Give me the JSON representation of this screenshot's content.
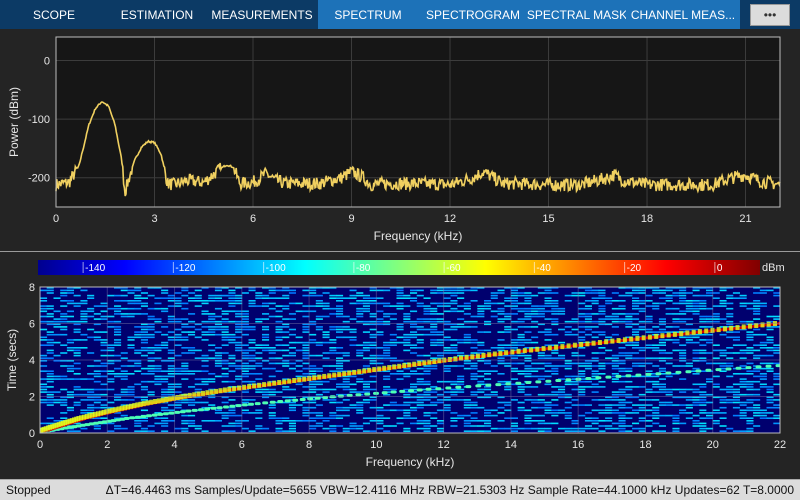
{
  "tabs": [
    {
      "label": "SCOPE",
      "group": 1,
      "w": 108
    },
    {
      "label": "ESTIMATION",
      "group": 1,
      "w": 98
    },
    {
      "label": "MEASUREMENTS",
      "group": 1,
      "w": 112
    },
    {
      "label": "SPECTRUM",
      "group": 2,
      "w": 100
    },
    {
      "label": "SPECTROGRAM",
      "group": 2,
      "w": 110
    },
    {
      "label": "SPECTRAL MASK",
      "group": 2,
      "w": 98
    },
    {
      "label": "CHANNEL MEAS...",
      "group": 2,
      "w": 114
    }
  ],
  "tab_more_icon": "overflow-menu-icon",
  "colors": {
    "spectrum_line": "#f0d060",
    "plot_bg": "#161616",
    "axes_text": "#e6e6e6"
  },
  "status": {
    "state": "Stopped",
    "readout": "ΔT=46.4463 ms  Samples/Update=5655  VBW=12.4116 MHz  RBW=21.5303 Hz  Sample Rate=44.1000 kHz  Updates=62  T=8.0000"
  },
  "chart_data": [
    {
      "type": "line",
      "title": "",
      "xlabel": "Frequency (kHz)",
      "ylabel": "Power (dBm)",
      "xlim": [
        0,
        22.05
      ],
      "ylim": [
        -250,
        40
      ],
      "xticks": [
        0,
        3,
        6,
        9,
        12,
        15,
        18,
        21
      ],
      "yticks": [
        0,
        -100,
        -200
      ],
      "grid": true,
      "series": [
        {
          "x": [
            0.0,
            0.4,
            0.7,
            1.0,
            1.2,
            1.4,
            1.6,
            1.8,
            2.0,
            2.1,
            2.2,
            2.4,
            2.6,
            2.8,
            3.0,
            3.2,
            3.4,
            3.6,
            4.0,
            4.5,
            5.0,
            5.2,
            5.4,
            5.6,
            6.0,
            6.4,
            6.7,
            7.0,
            8.0,
            8.7,
            9.0,
            9.3,
            9.6,
            10.0,
            11.0,
            12.0,
            12.7,
            13.0,
            13.2,
            13.6,
            14.0,
            15.0,
            16.0,
            16.8,
            17.0,
            17.3,
            18.0,
            19.0,
            20.0,
            20.6,
            21.0,
            21.4,
            22.05
          ],
          "y": [
            -212,
            -208,
            -180,
            -110,
            -82,
            -70,
            -78,
            -110,
            -170,
            -225,
            -205,
            -170,
            -148,
            -138,
            -140,
            -160,
            -210,
            -212,
            -205,
            -208,
            -185,
            -178,
            -182,
            -210,
            -208,
            -193,
            -205,
            -210,
            -210,
            -200,
            -190,
            -198,
            -212,
            -210,
            -210,
            -212,
            -200,
            -190,
            -196,
            -210,
            -210,
            -212,
            -212,
            -200,
            -195,
            -205,
            -212,
            -212,
            -212,
            -200,
            -195,
            -205,
            -212
          ]
        }
      ]
    },
    {
      "type": "heatmap",
      "title": "",
      "xlabel": "Frequency (kHz)",
      "ylabel": "Time (secs)",
      "xlim": [
        0,
        22
      ],
      "ylim": [
        0,
        8
      ],
      "xticks": [
        0,
        2,
        4,
        6,
        8,
        10,
        12,
        14,
        16,
        18,
        20,
        22
      ],
      "yticks": [
        0,
        2,
        4,
        6,
        8
      ],
      "colorbar": {
        "ticks": [
          -140,
          -120,
          -100,
          -80,
          -60,
          -40,
          -20,
          0
        ],
        "tick_labels": [
          "-140",
          "-120",
          "-100",
          "-80",
          "-60",
          "-40",
          "-20",
          "0"
        ],
        "units": "dBm",
        "range": [
          -150,
          10
        ]
      },
      "chirp": {
        "time": [
          0.05,
          0.4,
          0.8,
          1.2,
          1.6,
          2.0,
          2.4,
          2.8,
          3.2,
          3.6,
          4.0,
          4.4,
          4.8,
          5.2,
          5.6,
          6.0
        ],
        "freq": [
          0.0,
          0.6,
          1.3,
          2.2,
          3.2,
          4.4,
          5.8,
          7.4,
          9.0,
          10.6,
          12.2,
          14.0,
          16.0,
          18.0,
          20.0,
          22.0
        ]
      },
      "grid": true
    }
  ]
}
